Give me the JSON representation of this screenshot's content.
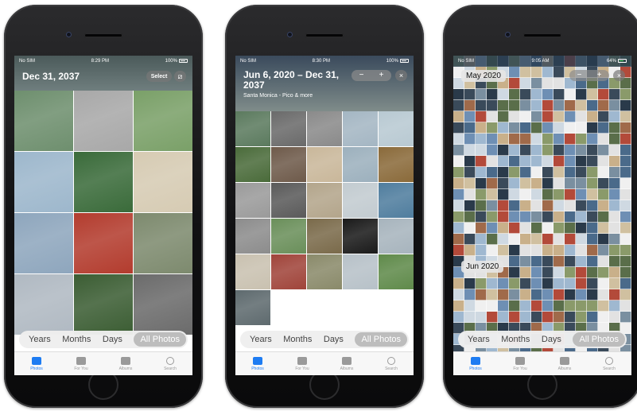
{
  "colors": {
    "accent": "#1e7cf2",
    "segment_active": "#bdbdbd"
  },
  "segment_labels": [
    "Years",
    "Months",
    "Days",
    "All Photos"
  ],
  "tabs": [
    {
      "label": "Photos",
      "icon": "photos-icon"
    },
    {
      "label": "For You",
      "icon": "for-you-icon"
    },
    {
      "label": "Albums",
      "icon": "albums-icon"
    },
    {
      "label": "Search",
      "icon": "search-icon"
    }
  ],
  "phones": [
    {
      "status": {
        "carrier": "No SIM",
        "time": "8:29 PM",
        "battery": "100%"
      },
      "title": "Dec 31, 2037",
      "select_label": "Select",
      "filter_glyph": "⧄",
      "photo_colors": [
        "#6e8f6e",
        "#a8a8a8",
        "#7aa068",
        "#9db7cc",
        "#3a6b3a",
        "#d6cbb3",
        "#8ea6bd",
        "#b33c2e",
        "#7d8a6e",
        "#b0b9c2",
        "#3b5d33",
        "#6b6b6b"
      ]
    },
    {
      "status": {
        "carrier": "No SIM",
        "time": "8:30 PM",
        "battery": "100%"
      },
      "title": "Jun 6, 2020 – Dec 31, 2037",
      "subtitle": "Santa Monica - Pico & more",
      "zoom_minus": "−",
      "zoom_plus": "+",
      "close_glyph": "×",
      "photo_colors": [
        "#5b7a5e",
        "#6a6a6a",
        "#8a8a8a",
        "#a4b6c3",
        "#b8c9d2",
        "#4a6b3a",
        "#6e5a4a",
        "#c9b79a",
        "#9cb0bd",
        "#8a6a3a",
        "#9a9a9a",
        "#5a5a5a",
        "#b3a58b",
        "#c2cbd0",
        "#4f7d9e",
        "#8c8c8c",
        "#6a8f5a",
        "#7a6a4a",
        "#1a1a1a",
        "#a7b4bd",
        "#c9c1b0",
        "#a0443a",
        "#8a8a6a",
        "#b7c1c8",
        "#5f8a4a",
        "#5e6a6e"
      ]
    },
    {
      "status": {
        "carrier": "No SIM",
        "time": "9:05 AM",
        "battery": "64%"
      },
      "month_top": "May 2020",
      "month_mid": "Jun 2020",
      "zoom_minus": "−",
      "zoom_plus": "+",
      "close_glyph": "×"
    }
  ]
}
